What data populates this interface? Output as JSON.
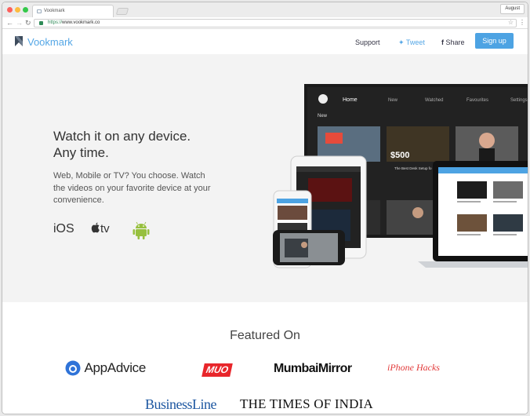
{
  "browser": {
    "tab_title": "Vookmark",
    "profile": "August",
    "url_scheme": "https://",
    "url_host": "www.vookmark.co"
  },
  "nav": {
    "logo": "Vookmark",
    "support": "Support",
    "tweet": "Tweet",
    "share": "Share",
    "signup": "Sign up"
  },
  "hero": {
    "title_line1": "Watch it on any device.",
    "title_line2": "Any time.",
    "subtitle": "Web, Mobile or TV? You choose. Watch the videos on your favorite device at your convenience.",
    "platforms": {
      "ios": "iOS",
      "apple_tv": "tv"
    }
  },
  "tv": {
    "menu": [
      "Home",
      "New",
      "Watched",
      "Favourites",
      "Settings"
    ],
    "section": "New",
    "video_title": "The Best Desk Setup fo"
  },
  "featured": {
    "title": "Featured On",
    "brands": [
      "AppAdvice",
      "MUO",
      "MumbaiMirror",
      "iPhone Hacks",
      "BusinessLine",
      "THE TIMES OF INDIA"
    ]
  },
  "colors": {
    "accent": "#4da3e3",
    "android": "#97c03e"
  }
}
